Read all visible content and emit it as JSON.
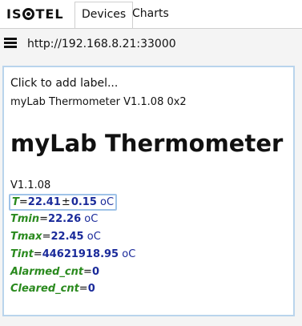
{
  "header": {
    "logo_text_pre": "IS",
    "logo_text_post": "TEL",
    "tabs": [
      {
        "label": "Devices",
        "active": true
      },
      {
        "label": "Charts",
        "active": false
      }
    ]
  },
  "urlbar": {
    "url": "http://192.168.8.21:33000"
  },
  "device": {
    "add_label": "Click to add label...",
    "subtitle": "myLab Thermometer V1.1.08 0x2",
    "title": "myLab Thermometer",
    "version": "V1.1.08",
    "variables": {
      "t": {
        "name": "T",
        "value": "22.41",
        "pm": "±",
        "uncertainty": "0.15",
        "unit": "oC"
      },
      "tmin": {
        "name": "Tmin",
        "value": "22.26",
        "unit": "oC"
      },
      "tmax": {
        "name": "Tmax",
        "value": "22.45",
        "unit": "oC"
      },
      "tint": {
        "name": "Tint",
        "value": "44621918.95",
        "unit": "oC"
      },
      "alarmed": {
        "name": "Alarmed_cnt",
        "value": "0"
      },
      "cleared": {
        "name": "Cleared_cnt",
        "value": "0"
      }
    },
    "equals_sign": "="
  },
  "colors": {
    "var_name": "#2a8a1e",
    "var_value": "#1a2a9a",
    "card_border": "#b9d4ec"
  }
}
